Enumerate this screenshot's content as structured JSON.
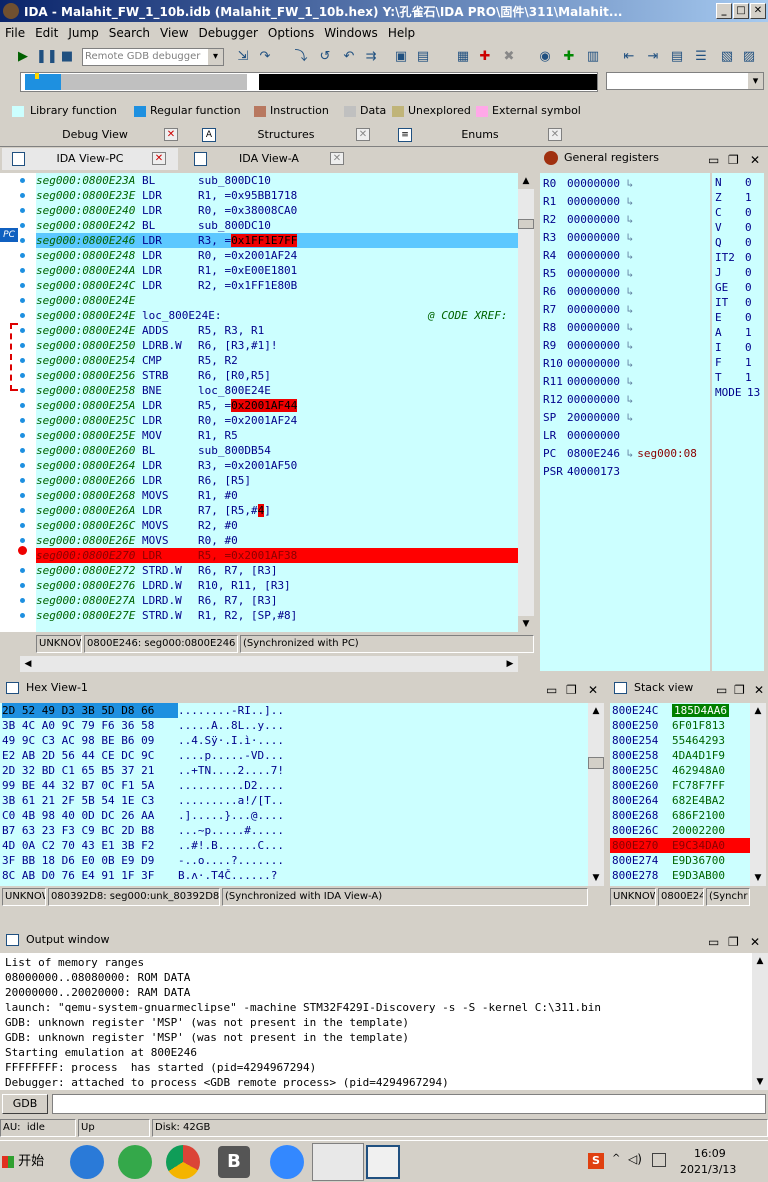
{
  "window": {
    "title": "IDA - Malahit_FW_1_10b.idb (Malahit_FW_1_10b.hex) Y:\\孔雀石\\IDA PRO\\固件\\311\\Malahit...",
    "min": "_",
    "max": "□",
    "close": "✕"
  },
  "menu": [
    "File",
    "Edit",
    "Jump",
    "Search",
    "View",
    "Debugger",
    "Options",
    "Windows",
    "Help"
  ],
  "toolbar": {
    "debugger_select": "Remote GDB debugger"
  },
  "legend": [
    {
      "label": "Library function",
      "color": "#ccffff"
    },
    {
      "label": "Regular function",
      "color": "#1e90e0"
    },
    {
      "label": "Instruction",
      "color": "#b87860"
    },
    {
      "label": "Data",
      "color": "#c0c0c0"
    },
    {
      "label": "Unexplored",
      "color": "#c0b478"
    },
    {
      "label": "External symbol",
      "color": "#ffa8e8"
    }
  ],
  "top_tabs": [
    "Debug View",
    "Structures",
    "Enums"
  ],
  "ida_tabs": [
    "IDA View-PC",
    "IDA View-A"
  ],
  "pc_label": "PC",
  "code_lines": [
    {
      "addr": "seg000:0800E23A",
      "op": "BL",
      "args": "sub_800DC10"
    },
    {
      "addr": "seg000:0800E23E",
      "op": "LDR",
      "args": "R1, =0x95BB1718"
    },
    {
      "addr": "seg000:0800E240",
      "op": "LDR",
      "args": "R0, =0x38008CA0"
    },
    {
      "addr": "seg000:0800E242",
      "op": "BL",
      "args": "sub_800DC10"
    },
    {
      "addr": "seg000:0800E246",
      "op": "LDR",
      "args": "R3, =",
      "tag": "0x1FF1E7FF",
      "hl": "pc"
    },
    {
      "addr": "seg000:0800E248",
      "op": "LDR",
      "args": "R0, =0x2001AF24"
    },
    {
      "addr": "seg000:0800E24A",
      "op": "LDR",
      "args": "R1, =0xE00E1801"
    },
    {
      "addr": "seg000:0800E24C",
      "op": "LDR",
      "args": "R2, =0x1FF1E80B"
    },
    {
      "addr": "seg000:0800E24E",
      "op": "",
      "args": ""
    },
    {
      "addr": "seg000:0800E24E",
      "op": "loc_800E24E:",
      "args": "",
      "xref": "@ CODE XREF:"
    },
    {
      "addr": "seg000:0800E24E",
      "op": "ADDS",
      "args": "R5, R3, R1"
    },
    {
      "addr": "seg000:0800E250",
      "op": "LDRB.W",
      "args": "R6, [R3,#1]!"
    },
    {
      "addr": "seg000:0800E254",
      "op": "CMP",
      "args": "R5, R2"
    },
    {
      "addr": "seg000:0800E256",
      "op": "STRB",
      "args": "R6, [R0,R5]"
    },
    {
      "addr": "seg000:0800E258",
      "op": "BNE",
      "args": "loc_800E24E"
    },
    {
      "addr": "seg000:0800E25A",
      "op": "LDR",
      "args": "R5, =",
      "tag": "0x2001AF44"
    },
    {
      "addr": "seg000:0800E25C",
      "op": "LDR",
      "args": "R0, =0x2001AF24"
    },
    {
      "addr": "seg000:0800E25E",
      "op": "MOV",
      "args": "R1, R5"
    },
    {
      "addr": "seg000:0800E260",
      "op": "BL",
      "args": "sub_800DB54"
    },
    {
      "addr": "seg000:0800E264",
      "op": "LDR",
      "args": "R3, =0x2001AF50"
    },
    {
      "addr": "seg000:0800E266",
      "op": "LDR",
      "args": "R6, [R5]"
    },
    {
      "addr": "seg000:0800E268",
      "op": "MOVS",
      "args": "R1, #0"
    },
    {
      "addr": "seg000:0800E26A",
      "op": "LDR",
      "args": "R7, [R5,#",
      "tag": "4",
      "tail": "]"
    },
    {
      "addr": "seg000:0800E26C",
      "op": "MOVS",
      "args": "R2, #0"
    },
    {
      "addr": "seg000:0800E26E",
      "op": "MOVS",
      "args": "R0, #0"
    },
    {
      "addr": "seg000:0800E270",
      "op": "LDR",
      "args": "R5, =0x2001AF38",
      "hl": "bp"
    },
    {
      "addr": "seg000:0800E272",
      "op": "STRD.W",
      "args": "R6, R7, [R3]"
    },
    {
      "addr": "seg000:0800E276",
      "op": "LDRD.W",
      "args": "R10, R11, [R3]"
    },
    {
      "addr": "seg000:0800E27A",
      "op": "LDRD.W",
      "args": "R6, R7, [R3]"
    },
    {
      "addr": "seg000:0800E27E",
      "op": "STRD.W",
      "args": "R1, R2, [SP,#8]"
    }
  ],
  "code_status": [
    "UNKNOWN",
    "0800E246: seg000:0800E246",
    "(Synchronized with PC)"
  ],
  "registers": {
    "title": "General registers",
    "rows": [
      {
        "name": "R0",
        "value": "00000000"
      },
      {
        "name": "R1",
        "value": "00000000"
      },
      {
        "name": "R2",
        "value": "00000000"
      },
      {
        "name": "R3",
        "value": "00000000"
      },
      {
        "name": "R4",
        "value": "00000000"
      },
      {
        "name": "R5",
        "value": "00000000"
      },
      {
        "name": "R6",
        "value": "00000000"
      },
      {
        "name": "R7",
        "value": "00000000"
      },
      {
        "name": "R8",
        "value": "00000000"
      },
      {
        "name": "R9",
        "value": "00000000"
      },
      {
        "name": "R10",
        "value": "00000000"
      },
      {
        "name": "R11",
        "value": "00000000"
      },
      {
        "name": "R12",
        "value": "00000000"
      },
      {
        "name": "SP",
        "value": "20000000"
      },
      {
        "name": "LR",
        "value": "00000000"
      },
      {
        "name": "PC",
        "value": "0800E246",
        "extra": "seg000:08"
      },
      {
        "name": "PSR",
        "value": "40000173"
      }
    ],
    "flags": [
      {
        "n": "N",
        "v": "0"
      },
      {
        "n": "Z",
        "v": "1"
      },
      {
        "n": "C",
        "v": "0"
      },
      {
        "n": "V",
        "v": "0"
      },
      {
        "n": "Q",
        "v": "0"
      },
      {
        "n": "IT2",
        "v": "0"
      },
      {
        "n": "J",
        "v": "0"
      },
      {
        "n": "GE",
        "v": "0"
      },
      {
        "n": "IT",
        "v": "0"
      },
      {
        "n": "E",
        "v": "0"
      },
      {
        "n": "A",
        "v": "1"
      },
      {
        "n": "I",
        "v": "0"
      },
      {
        "n": "F",
        "v": "1"
      },
      {
        "n": "T",
        "v": "1"
      },
      {
        "n": "MODE",
        "v": "13"
      }
    ]
  },
  "hex": {
    "title": "Hex View-1",
    "lines": [
      {
        "hex": "2D 52 49 D3 3B 5D D8 66",
        "ascii": "........-RI..]..",
        "sel": true
      },
      {
        "hex": "3B 4C A0 9C 79 F6 36 58",
        "ascii": ".....A..8L..y..."
      },
      {
        "hex": "49 9C C3 AC 98 BE B6 09",
        "ascii": "..4.Sÿ·.I.ì·...."
      },
      {
        "hex": "E2 AB 2D 56 44 CE DC 9C",
        "ascii": "....p.....-VD..."
      },
      {
        "hex": "2D 32 BD C1 65 B5 37 21",
        "ascii": "..+TN....2....7!"
      },
      {
        "hex": "99 BE 44 32 B7 0C F1 5A",
        "ascii": "..........D2...."
      },
      {
        "hex": "3B 61 21 2F 5B 54 1E C3",
        "ascii": ".........a!/[T.."
      },
      {
        "hex": "C0 4B 98 40 0D DC 26 AA",
        "ascii": ".].....}...@...."
      },
      {
        "hex": "B7 63 23 F3 C9 BC 2D B8",
        "ascii": "...~p.....#....."
      },
      {
        "hex": "4D 0A C2 70 43 E1 3B F2",
        "ascii": "..#!.B......C..."
      },
      {
        "hex": "3F BB 18 D6 E0 0B E9 D9",
        "ascii": "-..o....?......."
      },
      {
        "hex": "8C AB D0 76 E4 91 1F 3F",
        "ascii": "B.ʌ·.T4Č......?"
      }
    ],
    "status": [
      "UNKNOWN",
      "080392D8: seg000:unk_80392D8",
      "(Synchronized with IDA View-A)"
    ]
  },
  "stack": {
    "title": "Stack view",
    "rows": [
      {
        "addr": "800E24C",
        "val": "185D4AA6",
        "hl": "green"
      },
      {
        "addr": "800E250",
        "val": "6F01F813"
      },
      {
        "addr": "800E254",
        "val": "55464293"
      },
      {
        "addr": "800E258",
        "val": "4DA4D1F9"
      },
      {
        "addr": "800E25C",
        "val": "462948A0"
      },
      {
        "addr": "800E260",
        "val": "FC78F7FF"
      },
      {
        "addr": "800E264",
        "val": "682E4BA2"
      },
      {
        "addr": "800E268",
        "val": "686F2100"
      },
      {
        "addr": "800E26C",
        "val": "20002200"
      },
      {
        "addr": "800E270",
        "val": "E9C34DA0",
        "hl": "red"
      },
      {
        "addr": "800E274",
        "val": "E9D36700"
      },
      {
        "addr": "800E278",
        "val": "E9D3AB00"
      }
    ],
    "status": [
      "UNKNOWN",
      "0800E24",
      "(Synchr"
    ]
  },
  "output": {
    "title": "Output window",
    "lines": [
      "List of memory ranges",
      "08000000..08080000: ROM DATA",
      "20000000..20020000: RAM DATA",
      "launch: \"qemu-system-gnuarmeclipse\" -machine STM32F429I-Discovery -s -S -kernel C:\\311.bin",
      "GDB: unknown register 'MSP' (was not present in the template)",
      "GDB: unknown register 'MSP' (was not present in the template)",
      "Starting emulation at 800E246",
      "FFFFFFFF: process  has started (pid=4294967294)",
      "Debugger: attached to process <GDB remote process> (pid=4294967294)"
    ],
    "gdb_button": "GDB"
  },
  "statusbar": {
    "au": "AU:",
    "state": "idle",
    "dir": "Up",
    "disk": "Disk: 42GB"
  },
  "taskbar": {
    "start": "开始",
    "time": "16:09",
    "date": "2021/3/13",
    "lang": "S"
  }
}
